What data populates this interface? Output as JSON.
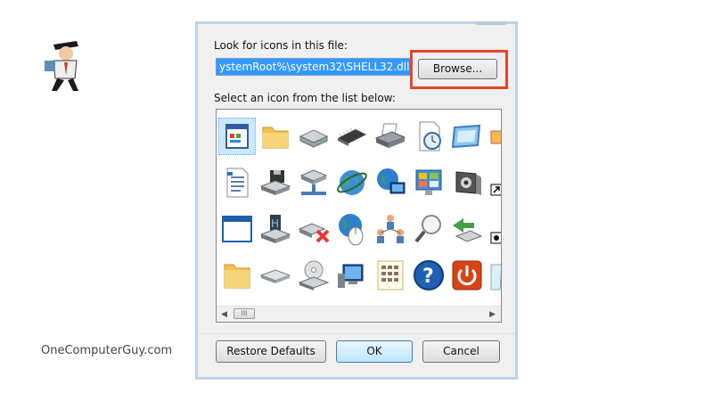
{
  "watermark": "OneComputerGuy.com",
  "dialog": {
    "look_label": "Look for icons in this file:",
    "file_path": "ystemRoot%\\system32\\SHELL32.dll",
    "browse_label": "Browse...",
    "select_label": "Select an icon from the list below:",
    "restore_label": "Restore Defaults",
    "ok_label": "OK",
    "cancel_label": "Cancel",
    "scroll_thumb": "III",
    "selected_icon": "document-window-icon",
    "highlight_color": "#e8442a"
  },
  "icons": [
    [
      "document-window-icon",
      "folder-icon",
      "drive-icon",
      "chip-icon",
      "printer-icon",
      "clock-doc-icon",
      "monitor-frame-icon",
      "partial-icon"
    ],
    [
      "text-doc-icon",
      "floppy-drive-icon",
      "network-drive-icon",
      "globe-network-icon",
      "globe-monitor-icon",
      "control-panel-icon",
      "speaker-monitor-icon",
      "shortcut-icon"
    ],
    [
      "window-icon",
      "floppy-device-icon",
      "drive-delete-icon",
      "globe-mouse-icon",
      "network-users-icon",
      "search-icon",
      "network-back-icon",
      "partial-icon-2"
    ],
    [
      "folder-icon-2",
      "disk-drive-icon",
      "cd-drive-icon",
      "computer-icon",
      "calculator-doc-icon",
      "help-icon",
      "power-icon",
      "recycle-icon"
    ]
  ]
}
